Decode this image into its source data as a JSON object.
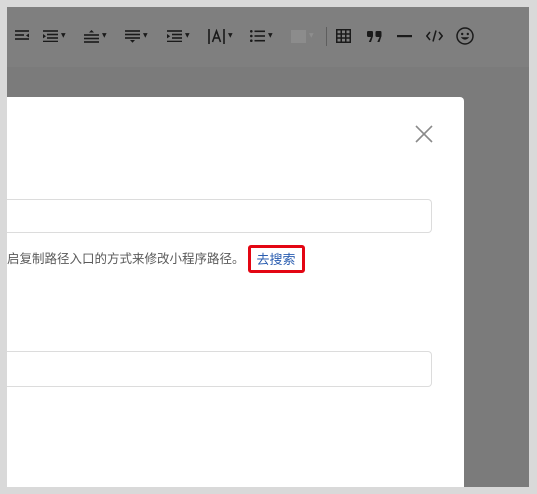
{
  "toolbar": {
    "icons": [
      "align-left-icon",
      "align-justify-icon",
      "line-height-icon",
      "paragraph-spacing-icon",
      "indent-icon",
      "letter-spacing-icon",
      "list-icon",
      "background-color-icon",
      "table-icon",
      "quote-icon",
      "horizontal-rule-icon",
      "code-icon",
      "emoji-icon"
    ]
  },
  "dialog": {
    "path_input_value": "",
    "hint_text": "启复制路径入口的方式来修改小程序路径。",
    "search_link_label": "去搜索",
    "second_input_value": ""
  },
  "colors": {
    "overlay": "#7b7b7b",
    "link": "#2a5db0",
    "highlight_border": "#e30613"
  }
}
